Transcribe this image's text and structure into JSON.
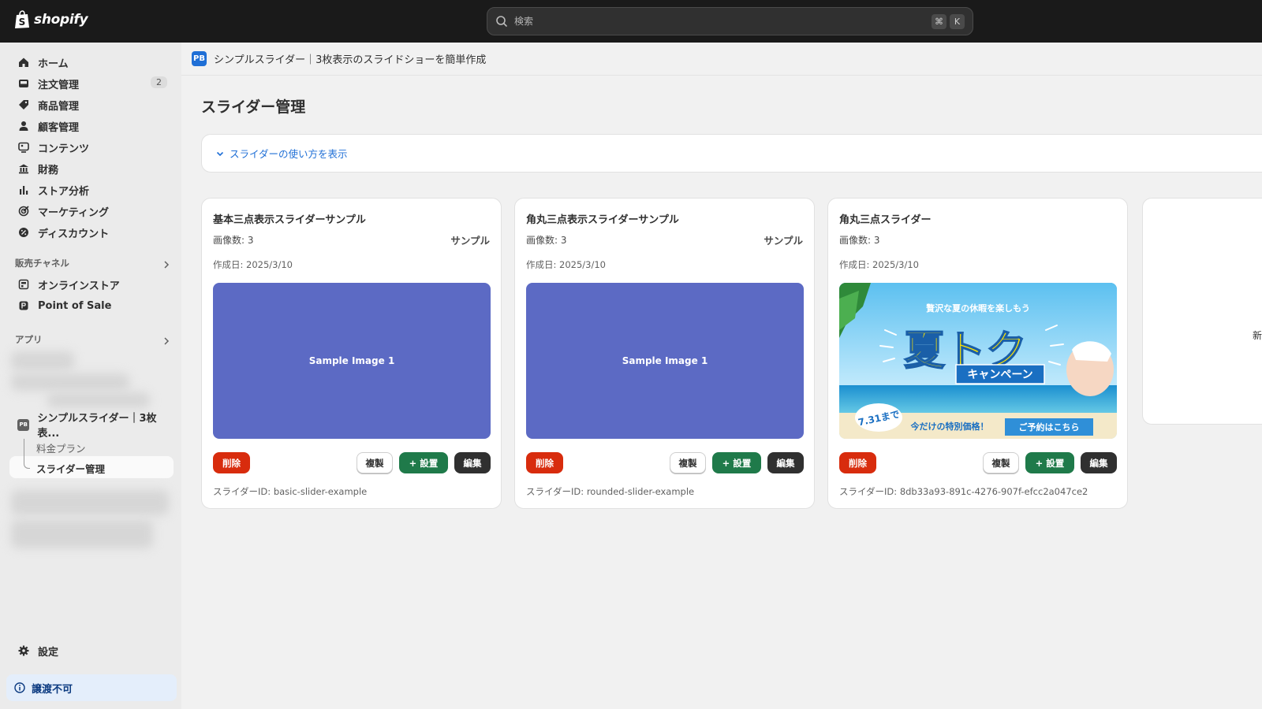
{
  "topbar": {
    "brand": "shopify",
    "search_placeholder": "検索",
    "shortcut_keys": [
      "⌘",
      "K"
    ]
  },
  "sidebar": {
    "items": [
      {
        "label": "ホーム",
        "icon": "home-icon"
      },
      {
        "label": "注文管理",
        "icon": "inbox-icon",
        "badge": "2"
      },
      {
        "label": "商品管理",
        "icon": "tag-icon"
      },
      {
        "label": "顧客管理",
        "icon": "person-icon"
      },
      {
        "label": "コンテンツ",
        "icon": "content-icon"
      },
      {
        "label": "財務",
        "icon": "bank-icon"
      },
      {
        "label": "ストア分析",
        "icon": "bar-chart-icon"
      },
      {
        "label": "マーケティング",
        "icon": "target-icon"
      },
      {
        "label": "ディスカウント",
        "icon": "discount-icon"
      }
    ],
    "sales_channels_label": "販売チャネル",
    "channels": [
      {
        "label": "オンラインストア",
        "icon": "store-icon"
      },
      {
        "label": "Point of Sale",
        "icon": "pos-icon"
      }
    ],
    "apps_label": "アプリ",
    "app_name": "シンプルスライダー｜3枚表...",
    "app_icon_text": "PB",
    "app_subitems": [
      "料金プラン",
      "スライダー管理"
    ],
    "settings_label": "設定",
    "footer_note": "譲渡不可"
  },
  "app_header": {
    "icon_text": "PB",
    "title": "シンプルスライダー｜3枚表示のスライドショーを簡単作成"
  },
  "main": {
    "page_title": "スライダー管理",
    "howto_link": "スライダーの使い方を表示",
    "new_card_label": "新規"
  },
  "cards": [
    {
      "title": "基本三点表示スライダーサンプル",
      "count": "画像数: 3",
      "tag": "サンプル",
      "date": "作成日: 2025/3/10",
      "image_text": "Sample Image 1",
      "delete": "削除",
      "duplicate": "複製",
      "install": "+ 設置",
      "edit": "編集",
      "id_text": "スライダーID: basic-slider-example"
    },
    {
      "title": "角丸三点表示スライダーサンプル",
      "count": "画像数: 3",
      "tag": "サンプル",
      "date": "作成日: 2025/3/10",
      "image_text": "Sample Image 1",
      "delete": "削除",
      "duplicate": "複製",
      "install": "+ 設置",
      "edit": "編集",
      "id_text": "スライダーID: rounded-slider-example"
    },
    {
      "title": "角丸三点スライダー",
      "count": "画像数: 3",
      "tag": "",
      "date": "作成日: 2025/3/10",
      "image_text": "",
      "delete": "削除",
      "duplicate": "複製",
      "install": "+ 設置",
      "edit": "編集",
      "id_text": "スライダーID: 8db33a93-891c-4276-907f-efcc2a047ce2"
    }
  ],
  "banner": {
    "tagline": "贅沢な夏の休暇を楽しもう",
    "headline": "夏トク",
    "campaign": "キャンペーン",
    "deadline": "7.31まで",
    "special_price": "今だけの特別価格！",
    "cta": "ご予約はこちら"
  },
  "colors": {
    "topbar": "#1a1a1a",
    "accent_link": "#1f6fd6",
    "danger": "#d82c0d",
    "success": "#1f7a4a",
    "sample_image": "#5c6ac4"
  }
}
